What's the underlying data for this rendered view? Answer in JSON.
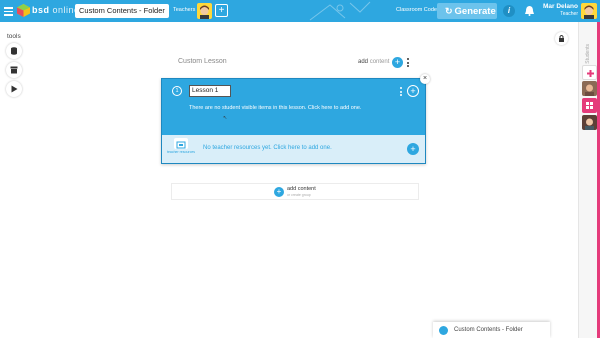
{
  "topbar": {
    "brand": "bsd",
    "brand_suffix": "online",
    "folder_name": "Custom Contents - Folder",
    "teachers_label": "Teachers",
    "add_teacher": "+",
    "classroom_code_label": "Classroom Code",
    "generate_label": "Generate",
    "info_label": "i",
    "user_name": "Mar Delano",
    "user_role": "Teacher",
    "accent_color": "#2ea7e0"
  },
  "tools": {
    "label": "tools",
    "items": [
      "database-icon",
      "archive-icon",
      "play-icon"
    ]
  },
  "sidebar": {
    "label": "Students",
    "accent_color": "#e53b7b"
  },
  "lesson": {
    "header": "Custom Lesson",
    "add_content_label": "add",
    "add_content_suffix": "content",
    "card": {
      "number": "1",
      "title": "Lesson 1",
      "empty_text": "There are no student visible items in this lesson. Click here to add one.",
      "teacher_resources_label": "teacher resources",
      "teacher_resources_text": "No teacher resources yet. Click here to add one."
    },
    "add_content_box": {
      "label": "add content",
      "sublabel": "or create group"
    }
  },
  "bottom_tab": {
    "label": "Custom Contents - Folder"
  }
}
